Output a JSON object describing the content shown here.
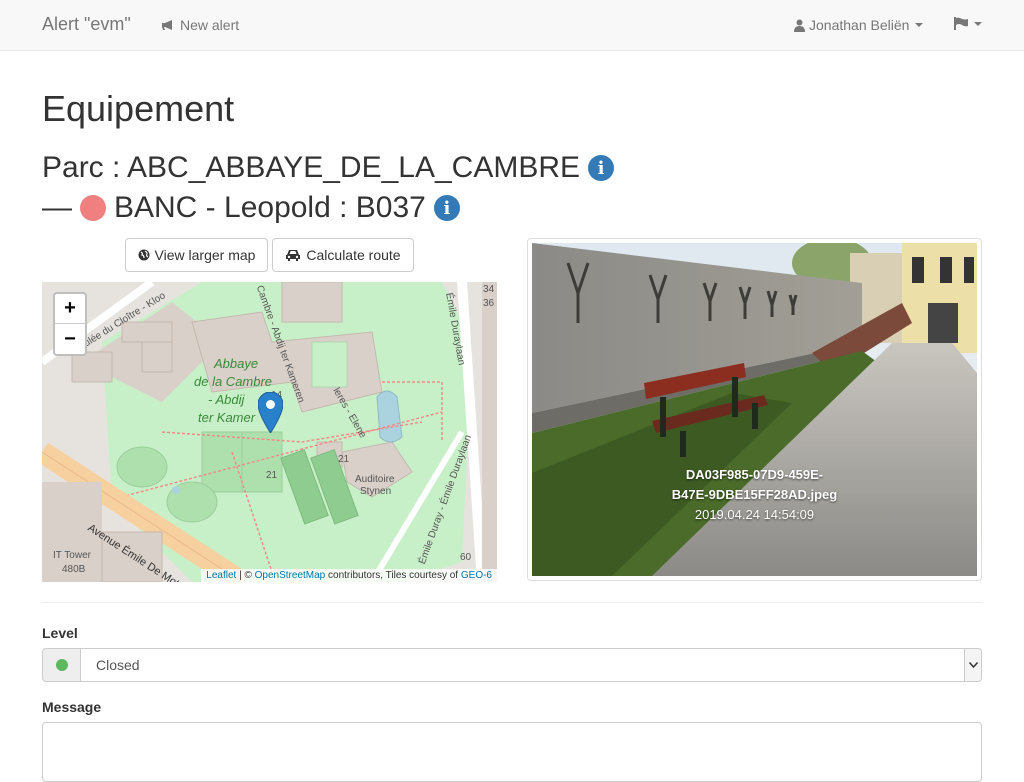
{
  "navbar": {
    "brand": "Alert \"evm\"",
    "new_alert": "New alert",
    "user": "Jonathan Beliën"
  },
  "page": {
    "title": "Equipement",
    "parc_line": "Parc : ABC_ABBAYE_DE_LA_CAMBRE",
    "item_prefix": "—",
    "item_line": "BANC - Leopold : B037",
    "status_color": "#f08080"
  },
  "buttons": {
    "view_larger_map": "View larger map",
    "calculate_route": "Calculate route"
  },
  "map": {
    "zoom_in": "+",
    "zoom_out": "−",
    "attribution": {
      "leaflet": "Leaflet",
      "sep": " | © ",
      "osm": "OpenStreetMap",
      "mid": " contributors, Tiles courtesy of ",
      "geo": "GEO-6"
    },
    "labels": {
      "abbaye1": "Abbaye",
      "abbaye2": "de la Cambre",
      "abbaye3": "- Abdij",
      "abbaye4": "ter Kamer",
      "auditoire1": "Auditoire",
      "auditoire2": "Stynen",
      "it_tower": "IT Tower",
      "n480b": "480B",
      "n14": "14",
      "n21a": "21",
      "n21b": "21",
      "n34": "34",
      "n36": "36",
      "n60": "60",
      "avenue": "Avenue Émile De Mot",
      "duray1": "Émile Duraylaan",
      "duray2": "Émile Duray - Émile Duraylaan",
      "cloitre": "ulée du Cloître - Kloo",
      "cambre": "Cambre - Abdij ter Kameren",
      "venes": "leres - Elene"
    }
  },
  "photo": {
    "filename_line1": "DA03F985-07D9-459E-",
    "filename_line2": "B47E-9DBE15FF28AD.jpeg",
    "timestamp": "2019.04.24 14:54:09"
  },
  "form": {
    "level_label": "Level",
    "level_value": "Closed",
    "level_dot_color": "#5cb85c",
    "message_label": "Message"
  },
  "icons": {
    "globe": "globe-icon",
    "car": "car-icon",
    "bullhorn": "bullhorn-icon",
    "user": "user-icon",
    "flag": "flag-icon",
    "info": "info-icon",
    "map_marker": "map-marker-icon"
  }
}
